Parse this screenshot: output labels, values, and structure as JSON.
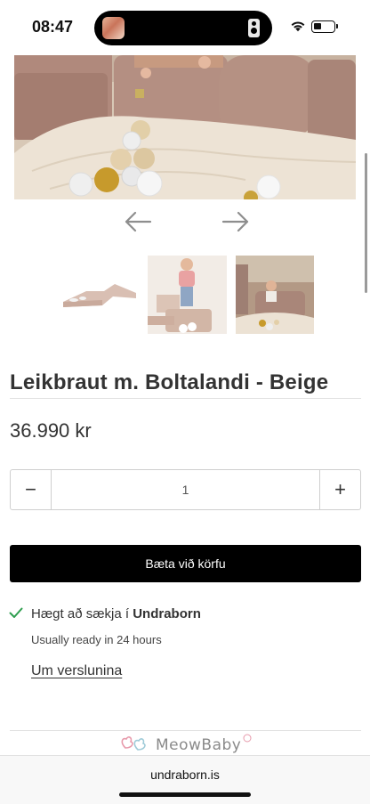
{
  "status_bar": {
    "time": "08:47"
  },
  "product": {
    "title": "Leikbraut m. Boltalandi - Beige",
    "price": "36.990 kr"
  },
  "quantity": {
    "minus_label": "−",
    "value": "1",
    "plus_label": "+"
  },
  "cart": {
    "add_button_label": "Bæta við körfu"
  },
  "pickup": {
    "prefix": "Hægt að sækja í",
    "store_name": "Undraborn",
    "ready_text": "Usually ready in 24 hours",
    "store_link_label": "Um verslunina"
  },
  "brand": {
    "logo_text": "MeowBaby"
  },
  "browser": {
    "url": "undraborn.is"
  },
  "colors": {
    "button_bg": "#000000",
    "check_green": "#2e9e4f",
    "upholstery": "#b8978a",
    "blanket": "#ece1d2"
  },
  "icons": {
    "wifi": "wifi-icon",
    "battery": "battery-icon",
    "prev": "arrow-left-icon",
    "next": "arrow-right-icon",
    "check": "checkmark-icon"
  }
}
